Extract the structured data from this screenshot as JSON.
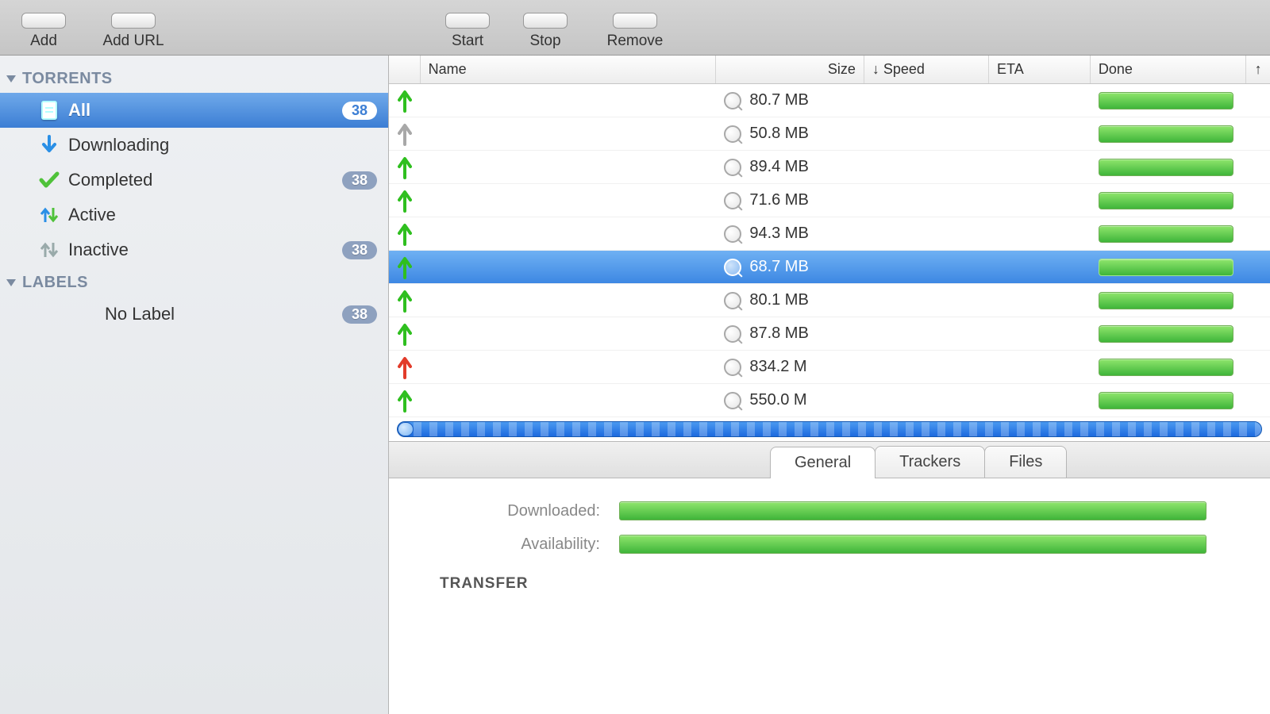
{
  "toolbar": {
    "add": "Add",
    "add_url": "Add URL",
    "start": "Start",
    "stop": "Stop",
    "remove": "Remove"
  },
  "sidebar": {
    "groups": [
      {
        "title": "TORRENTS",
        "items": [
          {
            "label": "All",
            "badge": "38",
            "selected": true,
            "icon": "doc"
          },
          {
            "label": "Downloading",
            "badge": "",
            "selected": false,
            "icon": "down"
          },
          {
            "label": "Completed",
            "badge": "38",
            "selected": false,
            "icon": "check"
          },
          {
            "label": "Active",
            "badge": "",
            "selected": false,
            "icon": "updown"
          },
          {
            "label": "Inactive",
            "badge": "38",
            "selected": false,
            "icon": "updown-gray"
          }
        ]
      },
      {
        "title": "LABELS",
        "items": [
          {
            "label": "No Label",
            "badge": "38",
            "selected": false,
            "icon": ""
          }
        ]
      }
    ]
  },
  "columns": {
    "name": "Name",
    "size": "Size",
    "speed": "↓ Speed",
    "eta": "ETA",
    "done": "Done",
    "up": "↑"
  },
  "rows": [
    {
      "arrow": "green",
      "size": "80.7 MB",
      "selected": false
    },
    {
      "arrow": "gray",
      "size": "50.8 MB",
      "selected": false
    },
    {
      "arrow": "green",
      "size": "89.4 MB",
      "selected": false
    },
    {
      "arrow": "green",
      "size": "71.6 MB",
      "selected": false
    },
    {
      "arrow": "green",
      "size": "94.3 MB",
      "selected": false
    },
    {
      "arrow": "green",
      "size": "68.7 MB",
      "selected": true
    },
    {
      "arrow": "green",
      "size": "80.1 MB",
      "selected": false
    },
    {
      "arrow": "green",
      "size": "87.8 MB",
      "selected": false
    },
    {
      "arrow": "red",
      "size": "834.2 M",
      "selected": false
    },
    {
      "arrow": "green",
      "size": "550.0 M",
      "selected": false
    }
  ],
  "tabs": [
    {
      "label": "General",
      "active": true
    },
    {
      "label": "Trackers",
      "active": false
    },
    {
      "label": "Files",
      "active": false
    }
  ],
  "details": {
    "downloaded_label": "Downloaded:",
    "availability_label": "Availability:",
    "transfer_header": "TRANSFER"
  },
  "colors": {
    "arrow_green": "#2fbf1f",
    "arrow_gray": "#a8a8a8",
    "arrow_red": "#e23b2a"
  }
}
